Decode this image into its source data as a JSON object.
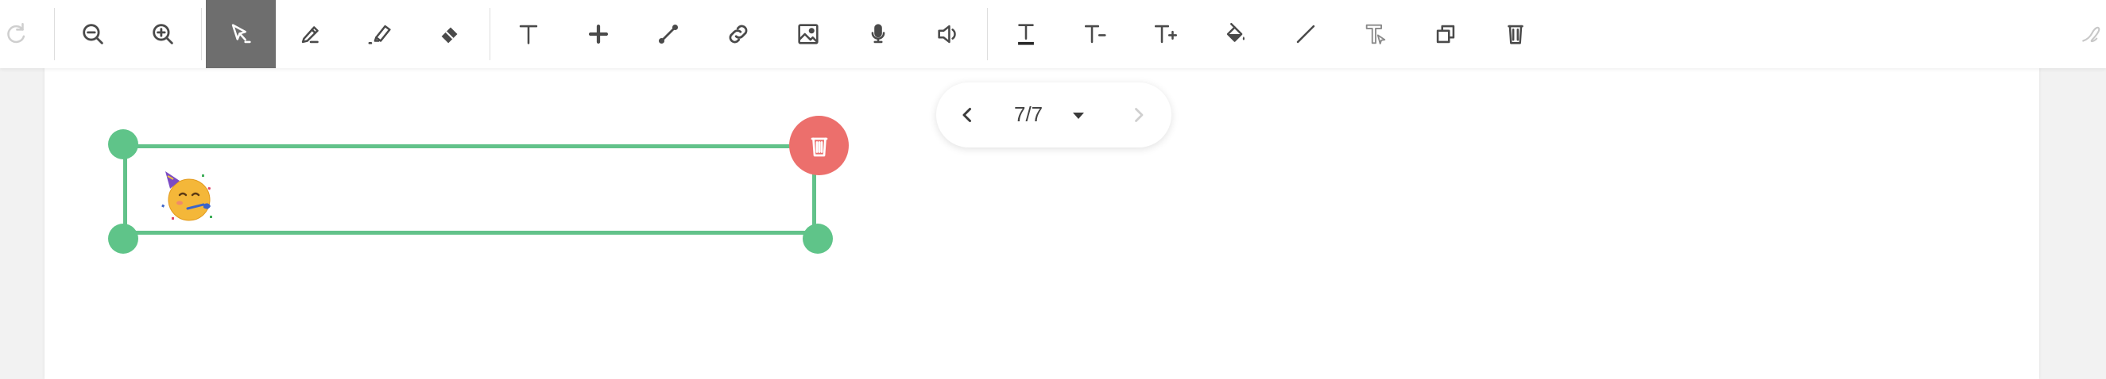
{
  "toolbar": {
    "buttons": [
      {
        "name": "redo-button",
        "icon": "redo-icon",
        "active": false
      },
      {
        "name": "zoom-out-button",
        "icon": "zoom-out-icon",
        "active": false
      },
      {
        "name": "zoom-in-button",
        "icon": "zoom-in-icon",
        "active": false
      },
      {
        "name": "select-tool-button",
        "icon": "cursor-select-icon",
        "active": true
      },
      {
        "name": "pen-tool-button",
        "icon": "pen-icon",
        "active": false
      },
      {
        "name": "highlighter-tool-button",
        "icon": "highlighter-icon",
        "active": false
      },
      {
        "name": "eraser-tool-button",
        "icon": "eraser-icon",
        "active": false
      },
      {
        "name": "text-tool-button",
        "icon": "text-icon",
        "active": false
      },
      {
        "name": "add-button",
        "icon": "plus-icon",
        "active": false
      },
      {
        "name": "connector-tool-button",
        "icon": "connector-icon",
        "active": false
      },
      {
        "name": "link-tool-button",
        "icon": "link-icon",
        "active": false
      },
      {
        "name": "image-tool-button",
        "icon": "image-icon",
        "active": false
      },
      {
        "name": "microphone-button",
        "icon": "microphone-icon",
        "active": false
      },
      {
        "name": "audio-button",
        "icon": "speaker-icon",
        "active": false
      },
      {
        "name": "text-color-button",
        "icon": "text-underline-icon",
        "active": false
      },
      {
        "name": "decrease-text-size-button",
        "icon": "text-minus-icon",
        "active": false
      },
      {
        "name": "increase-text-size-button",
        "icon": "text-plus-icon",
        "active": false
      },
      {
        "name": "fill-color-button",
        "icon": "paint-bucket-icon",
        "active": false
      },
      {
        "name": "line-tool-button",
        "icon": "line-icon",
        "active": false
      },
      {
        "name": "text-style-button",
        "icon": "text-format-icon",
        "active": false
      },
      {
        "name": "duplicate-button",
        "icon": "copy-icon",
        "active": false
      },
      {
        "name": "delete-toolbar-button",
        "icon": "trash-icon",
        "active": false
      },
      {
        "name": "signature-button",
        "icon": "signature-icon",
        "active": false
      }
    ]
  },
  "pager": {
    "label": "7/7",
    "prev_icon": "chevron-left-icon",
    "next_icon": "chevron-right-icon",
    "dropdown_icon": "caret-down-icon"
  },
  "selection": {
    "element_icon": "partying-face-emoji",
    "delete_icon": "trash-icon"
  },
  "colors": {
    "selection_green": "#5fc489",
    "delete_red": "#ec6f6c",
    "active_tool_bg": "#6e6e6e",
    "icon_dark": "#4a4a4a",
    "icon_light": "#cfcfcf"
  }
}
